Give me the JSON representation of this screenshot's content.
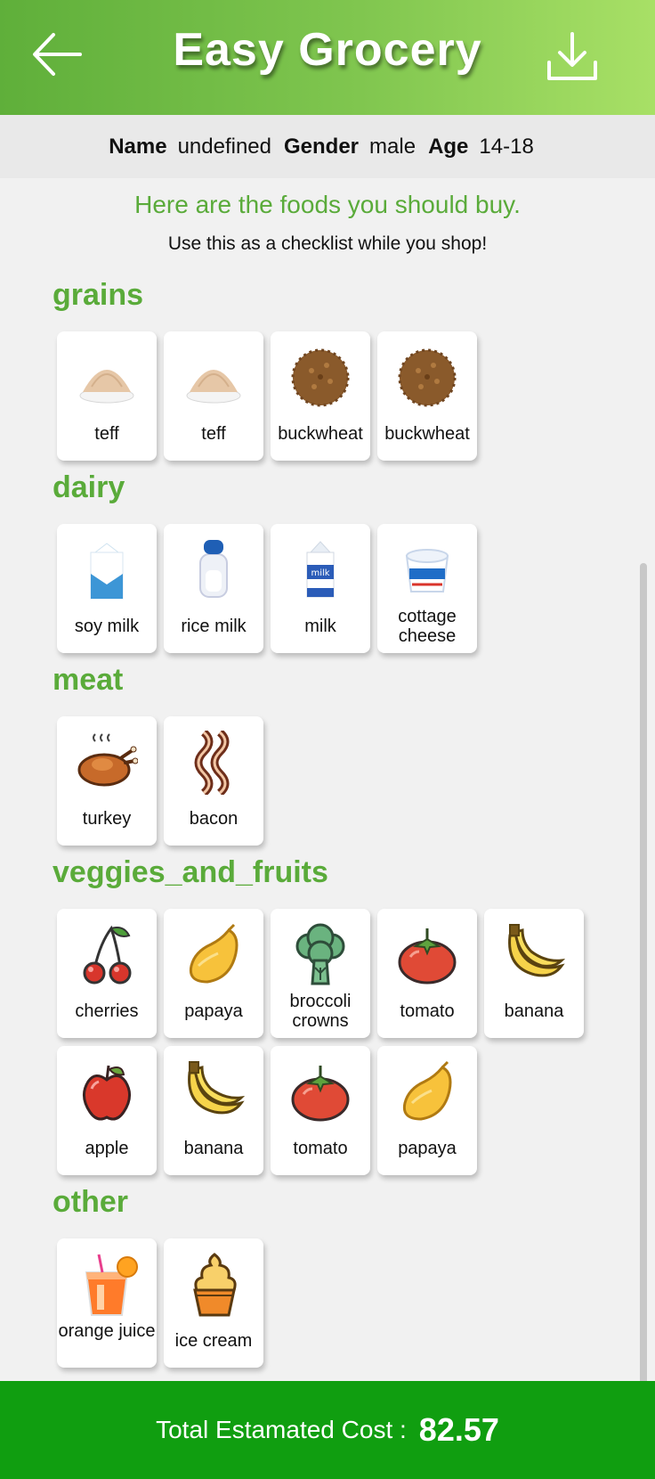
{
  "header": {
    "title": "Easy Grocery"
  },
  "user": {
    "name_label": "Name",
    "name_value": "undefined",
    "gender_label": "Gender",
    "gender_value": "male",
    "age_label": "Age",
    "age_value": "14-18"
  },
  "intro": {
    "headline": "Here are the foods you should buy.",
    "sub": "Use this as a checklist while you shop!"
  },
  "categories": [
    {
      "title": "grains",
      "items": [
        {
          "name": "teff",
          "icon": "teff-icon"
        },
        {
          "name": "teff",
          "icon": "teff-icon"
        },
        {
          "name": "buckwheat",
          "icon": "buckwheat-icon"
        },
        {
          "name": "buckwheat",
          "icon": "buckwheat-icon"
        }
      ]
    },
    {
      "title": "dairy",
      "items": [
        {
          "name": "soy milk",
          "icon": "soy-milk-icon"
        },
        {
          "name": "rice milk",
          "icon": "rice-milk-icon"
        },
        {
          "name": "milk",
          "icon": "milk-icon"
        },
        {
          "name": "cottage cheese",
          "icon": "cottage-cheese-icon"
        }
      ]
    },
    {
      "title": "meat",
      "items": [
        {
          "name": "turkey",
          "icon": "turkey-icon"
        },
        {
          "name": "bacon",
          "icon": "bacon-icon"
        }
      ]
    },
    {
      "title": "veggies_and_fruits",
      "items": [
        {
          "name": "cherries",
          "icon": "cherries-icon"
        },
        {
          "name": "papaya",
          "icon": "papaya-icon"
        },
        {
          "name": "broccoli crowns",
          "icon": "broccoli-icon"
        },
        {
          "name": "tomato",
          "icon": "tomato-icon"
        },
        {
          "name": "banana",
          "icon": "banana-icon"
        },
        {
          "name": "apple",
          "icon": "apple-icon"
        },
        {
          "name": "banana",
          "icon": "banana-icon"
        },
        {
          "name": "tomato",
          "icon": "tomato-icon"
        },
        {
          "name": "papaya",
          "icon": "papaya-icon"
        }
      ]
    },
    {
      "title": "other",
      "items": [
        {
          "name": "orange juice",
          "icon": "orange-juice-icon"
        },
        {
          "name": "ice cream",
          "icon": "ice-cream-icon"
        }
      ]
    }
  ],
  "footer": {
    "label": "Total Estamated Cost :",
    "cost": "82.57"
  },
  "colors": {
    "accent": "#5aab3a",
    "footer": "#109e10",
    "header_start": "#5faf3a",
    "header_end": "#a8e066"
  }
}
